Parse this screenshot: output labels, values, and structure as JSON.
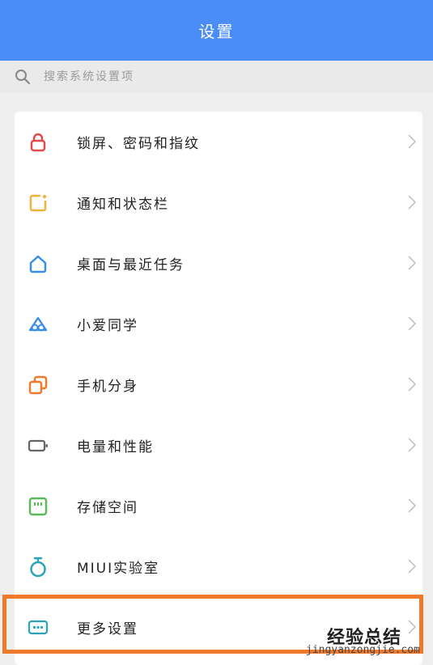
{
  "header": {
    "title": "设置"
  },
  "search": {
    "placeholder": "搜索系统设置项"
  },
  "settings": [
    {
      "label": "锁屏、密码和指纹",
      "icon": "lock-icon",
      "color": "#e24a4a"
    },
    {
      "label": "通知和状态栏",
      "icon": "notification-icon",
      "color": "#f2b33d"
    },
    {
      "label": "桌面与最近任务",
      "icon": "home-icon",
      "color": "#3a8ee6"
    },
    {
      "label": "小爱同学",
      "icon": "xiaoai-icon",
      "color": "#3a8ee6"
    },
    {
      "label": "手机分身",
      "icon": "dual-apps-icon",
      "color": "#ef7a2e"
    },
    {
      "label": "电量和性能",
      "icon": "battery-icon",
      "color": "#666666"
    },
    {
      "label": "存储空间",
      "icon": "storage-icon",
      "color": "#5cb85c"
    },
    {
      "label": "MIUI实验室",
      "icon": "lab-icon",
      "color": "#2aa3b8"
    },
    {
      "label": "更多设置",
      "icon": "more-settings-icon",
      "color": "#2aa3b8"
    }
  ],
  "watermark": {
    "text": "经验总结",
    "url": "jingyanzongjie.com"
  },
  "colors": {
    "header": "#4a8df6",
    "highlight": "#f07a2c"
  }
}
